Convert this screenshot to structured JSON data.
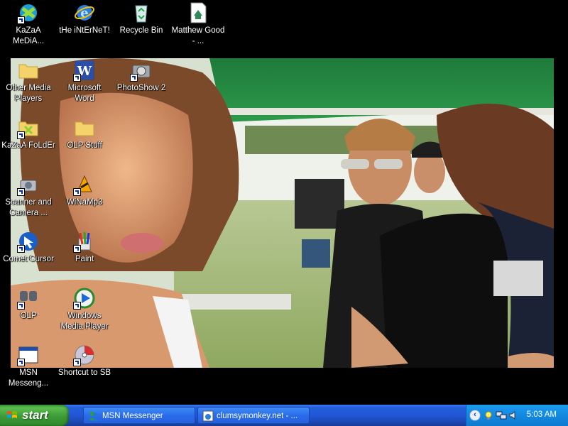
{
  "desktop": {
    "icons": [
      {
        "label": "KaZaA MeDiA..."
      },
      {
        "label": "tHe iNtErNeT!"
      },
      {
        "label": "Recycle Bin"
      },
      {
        "label": "Matthew Good - ..."
      },
      {
        "label": "Other Media Players"
      },
      {
        "label": "Microsoft Word"
      },
      {
        "label": "PhotoShow 2"
      },
      {
        "label": "KaZaA FoLdEr"
      },
      {
        "label": "OLP Stuff"
      },
      {
        "label": "Scanner and Camera ..."
      },
      {
        "label": "WiNaMp3"
      },
      {
        "label": "Comet Cursor"
      },
      {
        "label": "Paint"
      },
      {
        "label": "OLP"
      },
      {
        "label": "Windows Media Player"
      },
      {
        "label": "MSN Messeng..."
      },
      {
        "label": "Shortcut to SB"
      }
    ]
  },
  "taskbar": {
    "start_label": "start",
    "tasks": [
      {
        "label": "MSN Messenger"
      },
      {
        "label": "clumsymonkey.net - ..."
      }
    ],
    "clock": "5:03 AM"
  },
  "colors": {
    "taskbar_blue": "#245edb",
    "start_green": "#3d9a37",
    "tray_blue": "#1289e0"
  }
}
